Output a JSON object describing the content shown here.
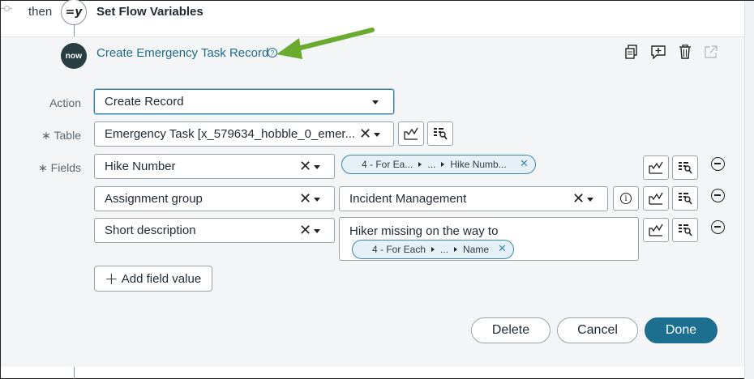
{
  "flow": {
    "then_label": "then",
    "step_icon_text": "=y",
    "step_title": "Set Flow Variables"
  },
  "action_header": {
    "logo_text": "now",
    "title": "Create Emergency Task Record",
    "help_icon": "?",
    "tools": [
      "copy-icon",
      "comment-icon",
      "trash-icon",
      "open-external-icon"
    ]
  },
  "form": {
    "action_label": "Action",
    "action_value": "Create Record",
    "table_label": "∗ Table",
    "table_value": "Emergency Task [x_579634_hobble_0_emer...",
    "fields_label": "∗ Fields",
    "fields": [
      {
        "name": "Hike Number",
        "value_pill": {
          "parts": [
            "4 - For Ea...",
            "...",
            "Hike Numb..."
          ]
        }
      },
      {
        "name": "Assignment group",
        "value_text": "Incident Management"
      },
      {
        "name": "Short description",
        "value_text": "Hiker missing on the way to",
        "value_pill": {
          "parts": [
            "4 - For Each",
            "...",
            "Name"
          ]
        }
      }
    ],
    "add_field_label": "Add field value"
  },
  "buttons": {
    "delete": "Delete",
    "cancel": "Cancel",
    "done": "Done"
  },
  "colors": {
    "accent": "#1d6f8f",
    "link": "#1e6b8c",
    "pill_border": "#3b86ad",
    "annotation_arrow": "#6aaa2e"
  }
}
